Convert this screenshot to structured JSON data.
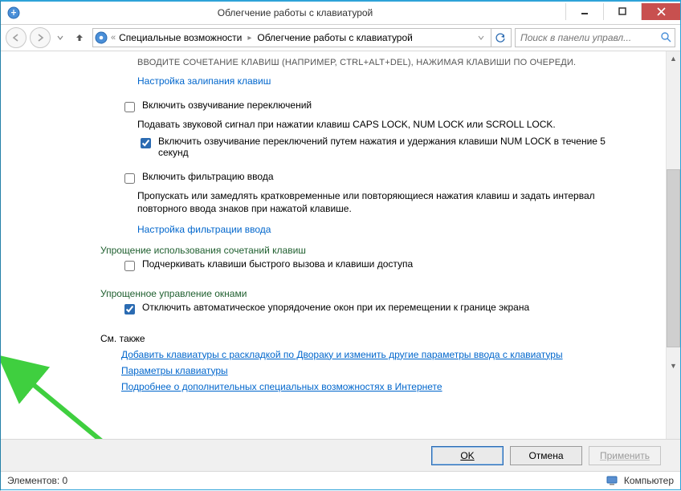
{
  "window": {
    "title": "Облегчение работы с клавиатурой"
  },
  "nav": {
    "crumb1": "Специальные возможности",
    "crumb2": "Облегчение работы с клавиатурой",
    "search_placeholder": "Поиск в панели управл..."
  },
  "body": {
    "truncated_top": "ВВОДИТЕ СОЧЕТАНИЕ КЛАВИШ (НАПРИМЕР, CTRL+ALT+DEL), НАЖИМАЯ КЛАВИШИ ПО ОЧЕРЕДИ.",
    "link_sticky": "Настройка залипания клавиш",
    "cb_toggle_sound_label": "Включить озвучивание переключений",
    "toggle_sound_desc": "Подавать звуковой сигнал при нажатии клавиш CAPS LOCK, NUM LOCK или SCROLL LOCK.",
    "cb_toggle_sound_numlock_label": "Включить озвучивание переключений путем нажатия и удержания клавиши NUM LOCK в течение 5 секунд",
    "cb_filter_label": "Включить фильтрацию ввода",
    "filter_desc": "Пропускать или замедлять кратковременные или повторяющиеся нажатия клавиш и задать интервал повторного ввода знаков при нажатой клавише.",
    "link_filter": "Настройка фильтрации ввода",
    "heading_shortcut": "Упрощение использования сочетаний клавиш",
    "cb_underline_label": "Подчеркивать клавиши быстрого вызова и клавиши доступа",
    "heading_windows": "Упрощенное управление окнами",
    "cb_snap_label": "Отключить автоматическое упорядочение окон при их перемещении к границе экрана",
    "heading_seealso": "См. также",
    "link_dvorak": "Добавить клавиатуры с раскладкой по Двораку и изменить другие параметры ввода с клавиатуры",
    "link_kbsettings": "Параметры клавиатуры",
    "link_learnmore": "Подробнее о дополнительных специальных возможностях в Интернете"
  },
  "buttons": {
    "ok": "OK",
    "cancel": "Отмена",
    "apply": "Применить"
  },
  "status": {
    "left": "Элементов: 0",
    "right": "Компьютер"
  },
  "checked": {
    "toggle_numlock": true,
    "snap": true
  }
}
